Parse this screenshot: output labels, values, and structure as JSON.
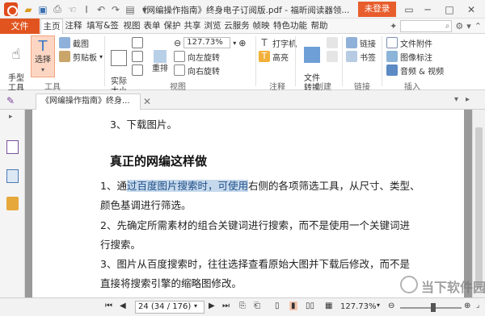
{
  "titlebar": {
    "doc_title": "《网编操作指南》终身电子订阅版.pdf - 福昕阅读器领...",
    "login_label": "未登录"
  },
  "ribbon_tabs": {
    "file": "文件",
    "tabs": [
      "主页",
      "注释",
      "填写&签名",
      "视图",
      "表单",
      "保护",
      "共享",
      "浏览",
      "云服务",
      "帧映",
      "特色功能",
      "帮助"
    ]
  },
  "ribbon": {
    "hand_tool": "手型\n工具",
    "select_tool": "选择",
    "screenshot": "截图",
    "clipboard": "剪贴板",
    "actual_size": "实际\n大小",
    "zoom_value": "127.73%",
    "rearrange": "重排",
    "rotate_left": "向左旋转",
    "rotate_right": "向右旋转",
    "typewriter": "打字机",
    "highlight": "高亮",
    "file_convert": "文件\n转换",
    "link": "链接",
    "bookmark": "书签",
    "file_attachment": "文件附件",
    "image_annotation": "图像标注",
    "audio_video": "音频 & 视频",
    "groups": {
      "tools": "工具",
      "view": "视图",
      "comment": "注释",
      "create": "创建",
      "links": "链接",
      "insert": "插入"
    }
  },
  "doc_tab": {
    "label": "《网编操作指南》终身..."
  },
  "document": {
    "line_download": "3、下载图片。",
    "heading": "真正的网编这样做",
    "p1_before": "1、通",
    "p1_highlight": "过百度图片搜索时，可使用",
    "p1_after": "右侧的各项筛选工具，从尺寸、类型、",
    "p1_line2": "颜色基调进行筛选。",
    "p2_line1": "2、先确定所需素材的组合关键词进行搜索，而不是使用一个关键词进",
    "p2_line2": "行搜索。",
    "p3_line1": "3、图片从百度搜索时，往往选择查看原始大图并下载后修改，而不是",
    "p3_line2": "直接将搜索引擎的缩略图修改。"
  },
  "statusbar": {
    "page_field": "24 (34 / 176)",
    "zoom": "127.73%",
    "zoom_progress": 0.5
  },
  "watermark": {
    "text": "当下软件园"
  },
  "colors": {
    "brand": "#e1541f",
    "highlight_bg": "#c6d9ec",
    "highlight_text": "#1f4f89"
  }
}
